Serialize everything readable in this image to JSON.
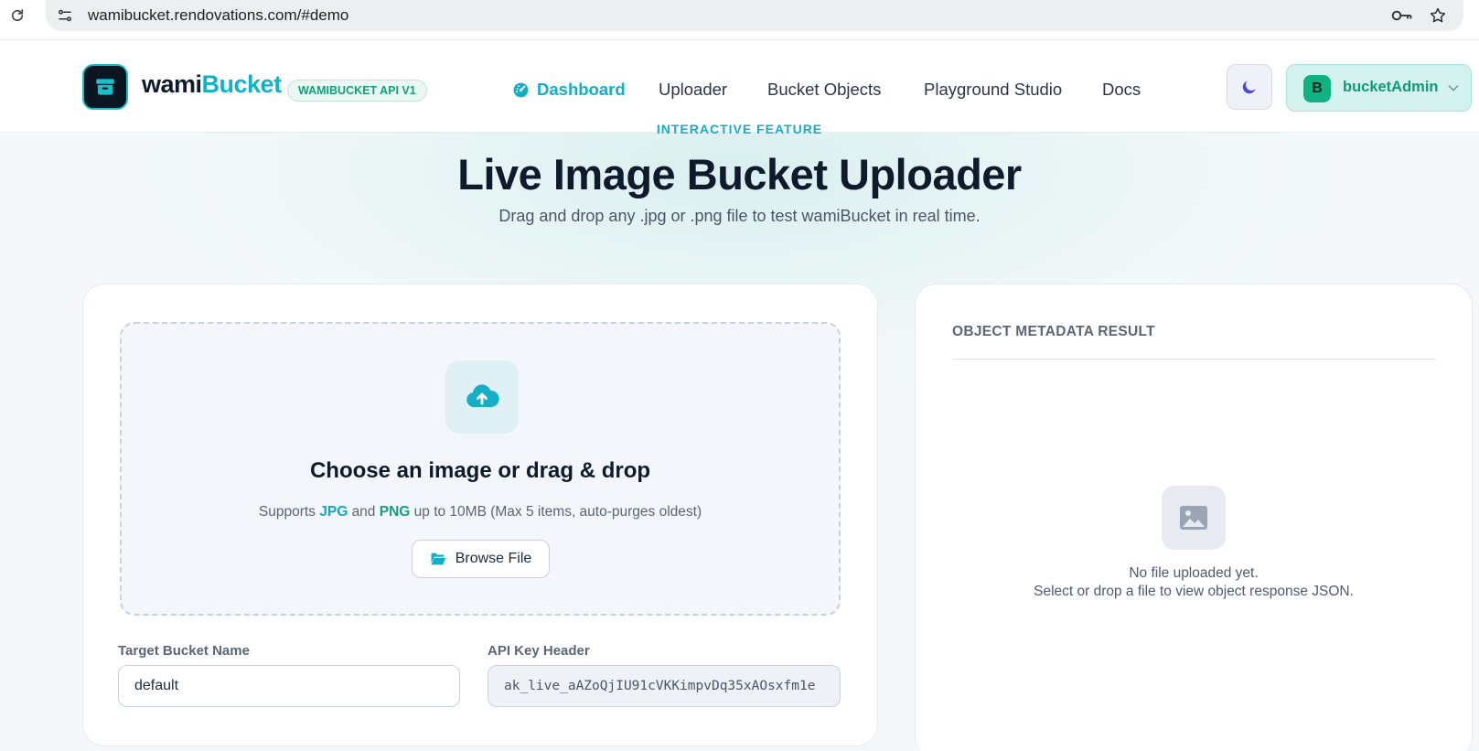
{
  "browser": {
    "url": "wamibucket.rendovations.com/#demo"
  },
  "header": {
    "brand_part1": "wami",
    "brand_part2": "Bucket",
    "api_badge": "WAMIBUCKET API V1",
    "nav": [
      {
        "label": "Dashboard",
        "active": true
      },
      {
        "label": "Uploader",
        "active": false
      },
      {
        "label": "Bucket Objects",
        "active": false
      },
      {
        "label": "Playground Studio",
        "active": false
      },
      {
        "label": "Docs",
        "active": false
      }
    ],
    "user": {
      "initial": "B",
      "name": "bucketAdmin"
    }
  },
  "hero": {
    "eyebrow": "INTERACTIVE FEATURE",
    "title": "Live Image Bucket Uploader",
    "subtitle": "Drag and drop any .jpg or .png file to test wamiBucket in real time."
  },
  "uploader": {
    "dropzone_title": "Choose an image or drag & drop",
    "sub_prefix": "Supports",
    "sub_jpg": "JPG",
    "sub_and": "and",
    "sub_png": "PNG",
    "sub_suffix": "up to 10MB (Max 5 items, auto-purges oldest)",
    "browse_label": "Browse File",
    "bucket_label": "Target Bucket Name",
    "bucket_value": "default",
    "api_key_label": "API Key Header",
    "api_key_value": "ak_live_aAZoQjIU91cVKKimpvDq35xAOsxfm1e"
  },
  "metadata": {
    "title": "OBJECT METADATA RESULT",
    "empty_line1": "No file uploaded yet.",
    "empty_line2": "Select or drop a file to view object response JSON."
  },
  "colors": {
    "accent": "#14aec6",
    "green": "#13a07a",
    "dark": "#0f1a2c"
  },
  "icons": [
    "reload-icon",
    "site-info-icon",
    "key-icon",
    "star-icon",
    "bucket-logo-icon",
    "dashboard-icon",
    "moon-icon",
    "chevron-down-icon",
    "cloud-upload-icon",
    "folder-open-icon",
    "image-icon"
  ]
}
